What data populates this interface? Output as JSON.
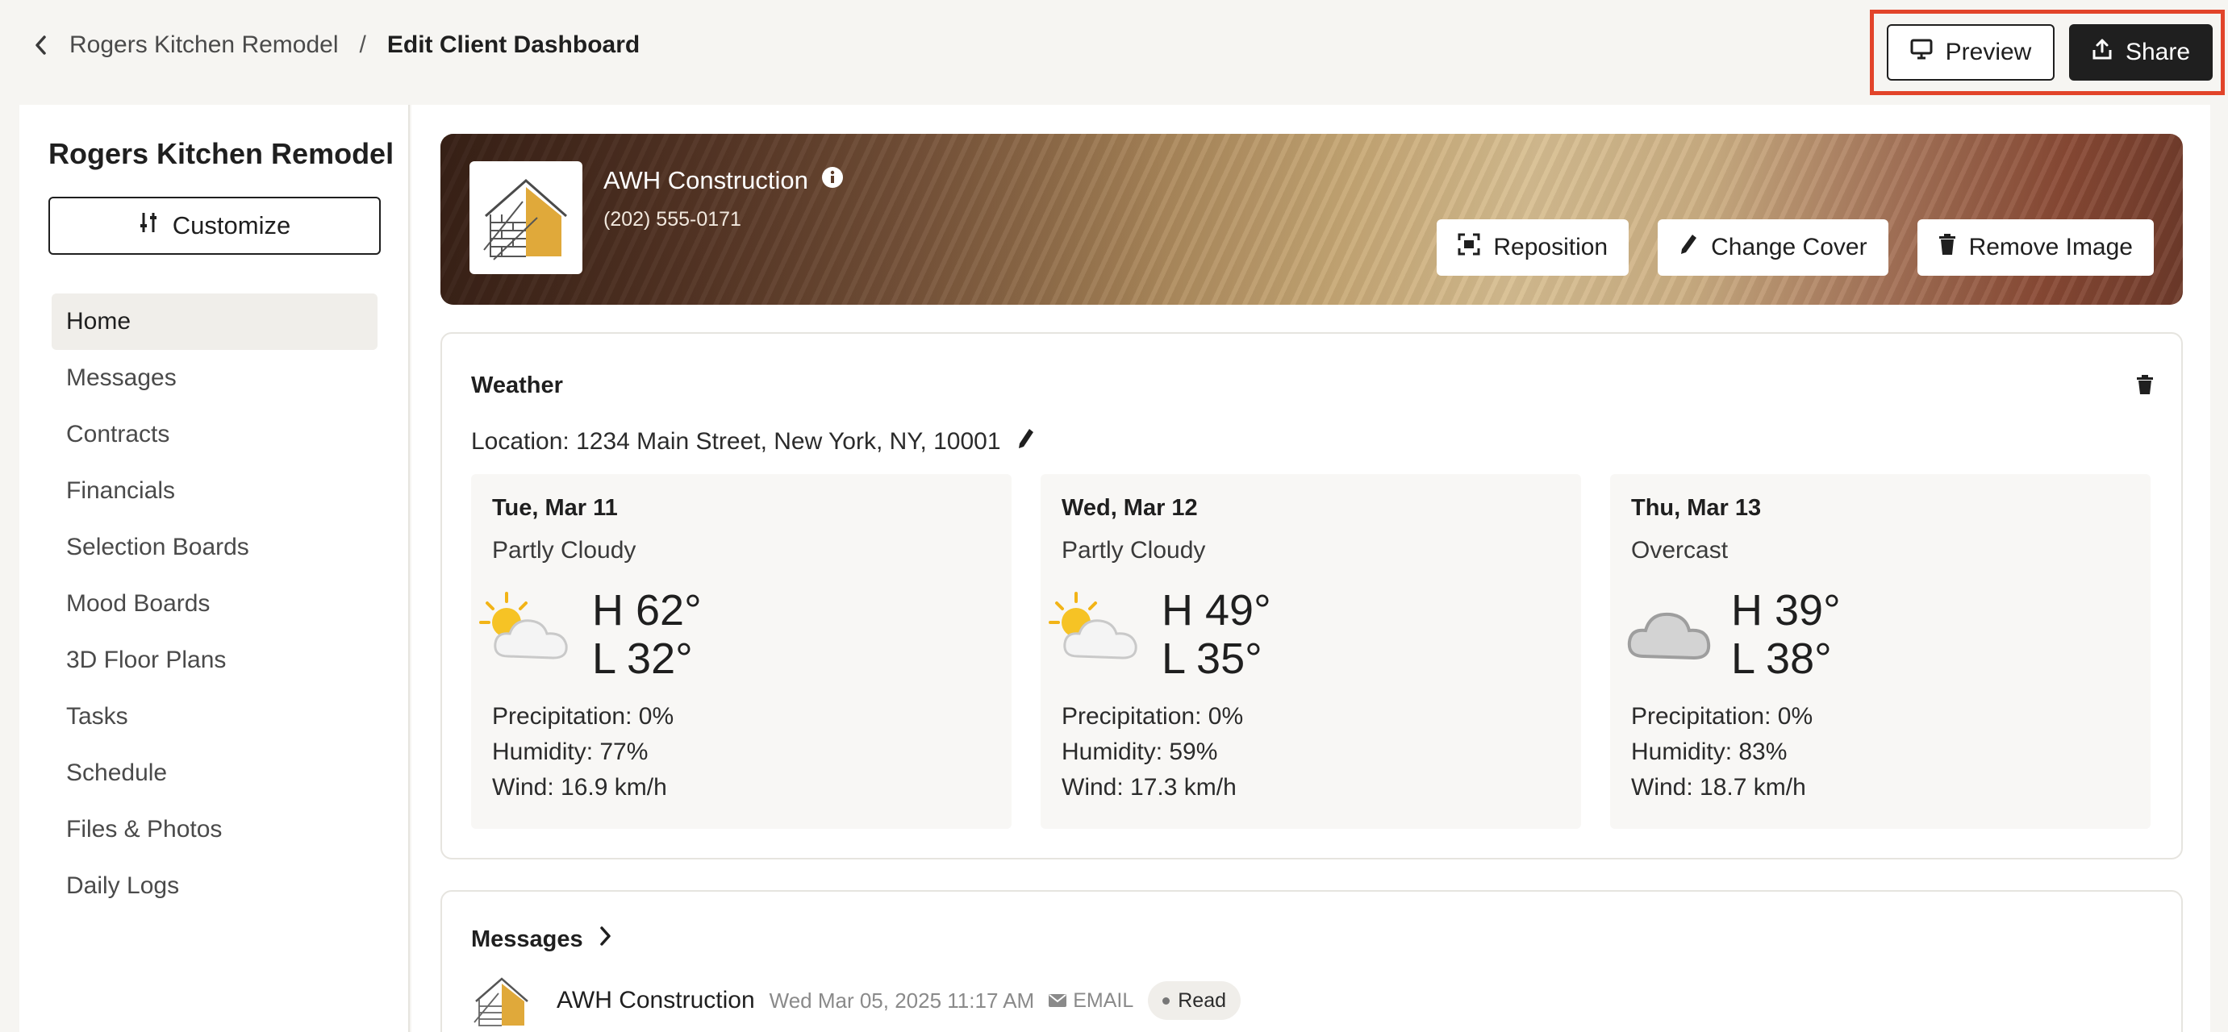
{
  "breadcrumb": {
    "parent": "Rogers Kitchen Remodel",
    "separator": "/",
    "current": "Edit Client Dashboard"
  },
  "actions": {
    "preview_label": "Preview",
    "share_label": "Share"
  },
  "sidebar": {
    "title": "Rogers Kitchen Remodel",
    "customize_label": "Customize",
    "items": [
      {
        "label": "Home",
        "active": true
      },
      {
        "label": "Messages"
      },
      {
        "label": "Contracts"
      },
      {
        "label": "Financials"
      },
      {
        "label": "Selection Boards"
      },
      {
        "label": "Mood Boards"
      },
      {
        "label": "3D Floor Plans"
      },
      {
        "label": "Tasks"
      },
      {
        "label": "Schedule"
      },
      {
        "label": "Files & Photos"
      },
      {
        "label": "Daily Logs"
      }
    ]
  },
  "cover": {
    "company": "AWH Construction",
    "phone": "(202) 555-0171",
    "reposition_label": "Reposition",
    "change_cover_label": "Change Cover",
    "remove_image_label": "Remove Image"
  },
  "weather": {
    "title": "Weather",
    "location": "Location: 1234 Main Street, New York, NY, 10001",
    "days": [
      {
        "date": "Tue, Mar 11",
        "condition": "Partly Cloudy",
        "icon": "partly-cloudy-icon",
        "high": "H 62°",
        "low": "L 32°",
        "precip": "Precipitation: 0%",
        "humidity": "Humidity: 77%",
        "wind": "Wind: 16.9 km/h"
      },
      {
        "date": "Wed, Mar 12",
        "condition": "Partly Cloudy",
        "icon": "partly-cloudy-icon",
        "high": "H 49°",
        "low": "L 35°",
        "precip": "Precipitation: 0%",
        "humidity": "Humidity: 59%",
        "wind": "Wind: 17.3 km/h"
      },
      {
        "date": "Thu, Mar 13",
        "condition": "Overcast",
        "icon": "overcast-icon",
        "high": "H 39°",
        "low": "L 38°",
        "precip": "Precipitation: 0%",
        "humidity": "Humidity: 83%",
        "wind": "Wind: 18.7 km/h"
      }
    ]
  },
  "messages": {
    "title": "Messages",
    "items": [
      {
        "sender": "AWH Construction",
        "timestamp": "Wed Mar 05, 2025 11:17 AM",
        "channel": "EMAIL",
        "status": "Read"
      }
    ]
  },
  "colors": {
    "accent_highlight": "#e2442a",
    "dark_button": "#1f1f1f"
  }
}
